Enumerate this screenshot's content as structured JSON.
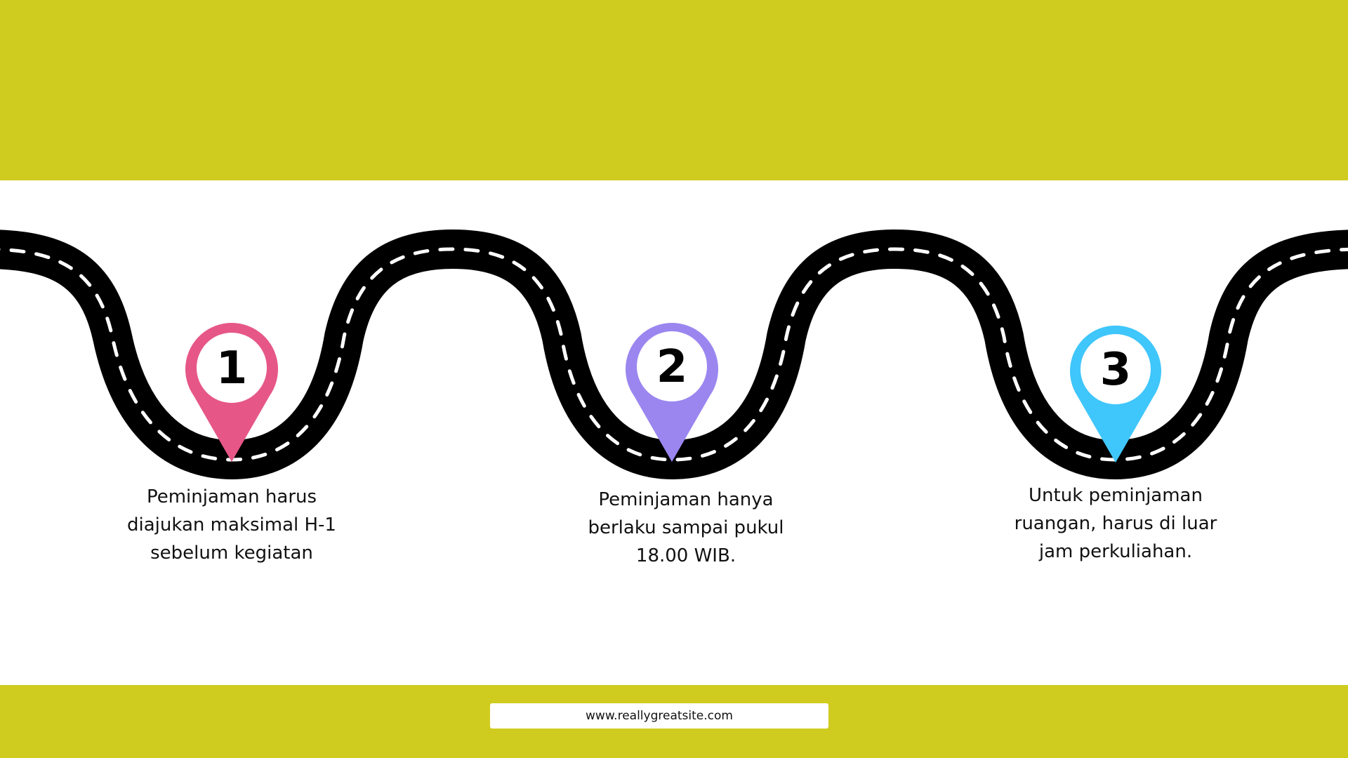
{
  "colors": {
    "band": "#d0cc1f",
    "road": "#000000",
    "lane": "#ffffff",
    "pin1": "#e65787",
    "pin2": "#9b86f0",
    "pin3": "#3fc6fb"
  },
  "steps": [
    {
      "number": "1",
      "text_lines": [
        "Peminjaman harus",
        "diajukan maksimal H-1",
        "sebelum kegiatan"
      ]
    },
    {
      "number": "2",
      "text_lines": [
        "Peminjaman hanya",
        "berlaku sampai pukul",
        "18.00 WIB."
      ]
    },
    {
      "number": "3",
      "text_lines": [
        "Untuk peminjaman",
        "ruangan, harus di luar",
        "jam perkuliahan."
      ]
    }
  ],
  "footer": {
    "url": "www.reallygreatsite.com"
  }
}
